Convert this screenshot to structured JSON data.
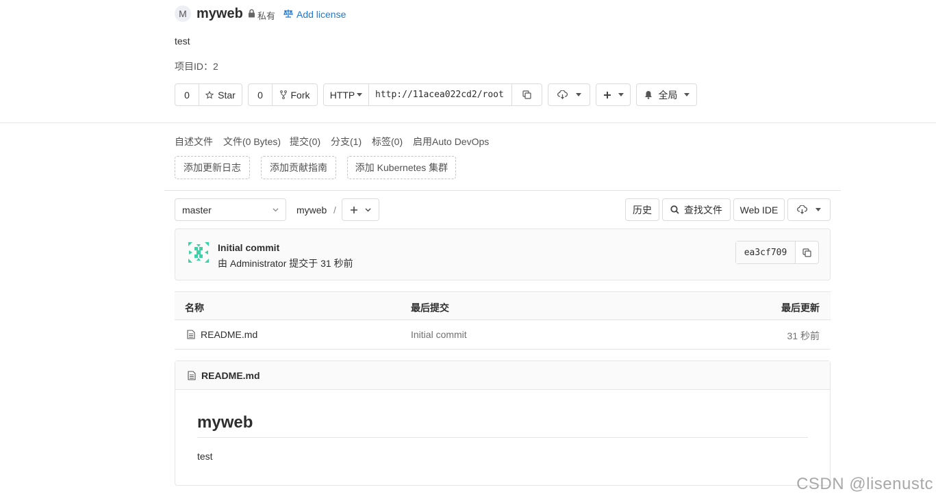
{
  "project": {
    "avatar_letter": "M",
    "name": "myweb",
    "visibility": "私有",
    "add_license": "Add license",
    "description": "test",
    "id_label": "项目ID：",
    "id_value": "2"
  },
  "actions": {
    "star_count": "0",
    "star_label": "Star",
    "fork_count": "0",
    "fork_label": "Fork",
    "protocol": "HTTP",
    "clone_url": "http://11acea022cd2/root",
    "notification_label": "全局"
  },
  "nav": {
    "items": [
      "自述文件",
      "文件(0 Bytes)",
      "提交(0)",
      "分支(1)",
      "标签(0)",
      "启用Auto DevOps"
    ]
  },
  "suggestions": [
    "添加更新日志",
    "添加贡献指南",
    "添加 Kubernetes 集群"
  ],
  "toolbar": {
    "branch": "master",
    "path_root": "myweb",
    "path_sep": "/",
    "history": "历史",
    "find_file": "查找文件",
    "web_ide": "Web IDE"
  },
  "commit": {
    "title": "Initial commit",
    "author_line": "由 Administrator 提交于 31 秒前",
    "sha": "ea3cf709"
  },
  "file_table": {
    "headers": [
      "名称",
      "最后提交",
      "最后更新"
    ],
    "rows": [
      {
        "name": "README.md",
        "last_commit": "Initial commit",
        "updated": "31 秒前"
      }
    ]
  },
  "readme": {
    "file_name": "README.md",
    "heading": "myweb",
    "body": "test"
  },
  "watermark": "CSDN @lisenustc",
  "colors": {
    "link": "#1f78d1",
    "border": "#dbdbdb",
    "avatar_bg": "#eeeef5",
    "identicon": "#3fd1a6"
  }
}
